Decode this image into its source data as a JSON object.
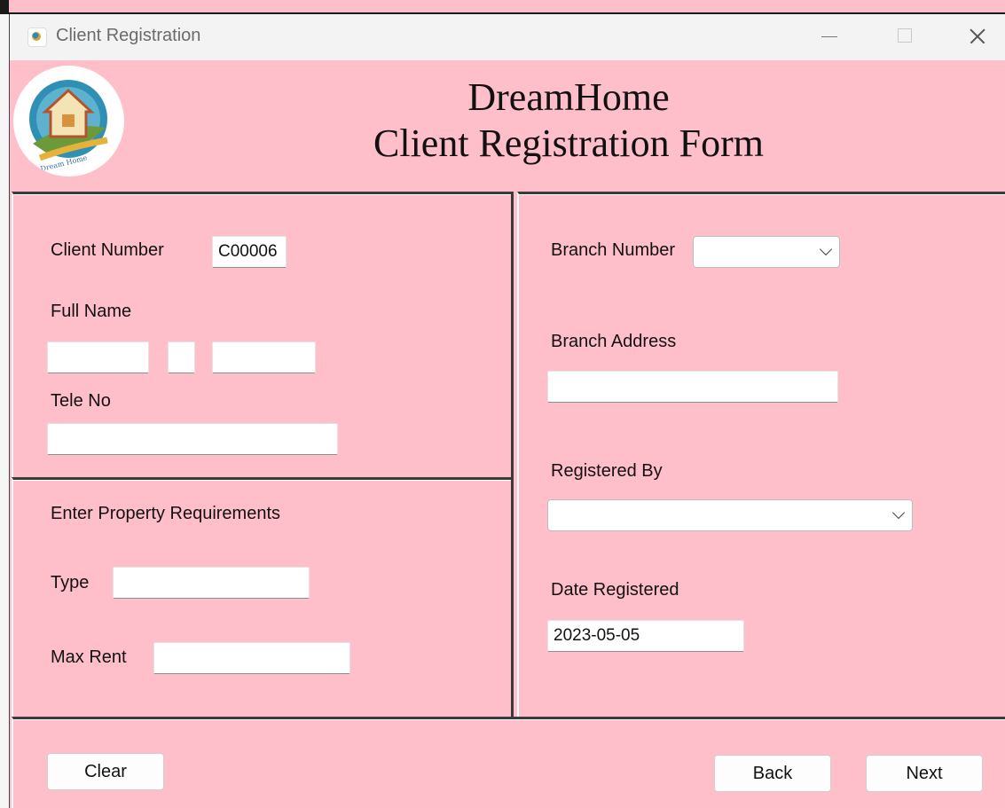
{
  "window": {
    "title": "Client Registration",
    "icon": "app-logo-icon"
  },
  "header": {
    "line1": "DreamHome",
    "line2": "Client Registration Form",
    "logo_text": "Dream Home"
  },
  "client": {
    "number_label": "Client Number",
    "number_value": "C00006",
    "full_name_label": "Full Name",
    "first_name_value": "",
    "middle_initial_value": "",
    "last_name_value": "",
    "tele_label": "Tele No",
    "tele_value": ""
  },
  "requirements": {
    "heading": "Enter Property Requirements",
    "type_label": "Type",
    "type_value": "",
    "max_rent_label": "Max Rent",
    "max_rent_value": ""
  },
  "branch": {
    "number_label": "Branch Number",
    "number_selected": "",
    "address_label": "Branch Address",
    "address_value": "",
    "registered_by_label": "Registered By",
    "registered_by_selected": "",
    "date_label": "Date Registered",
    "date_value": "2023-05-05"
  },
  "buttons": {
    "clear": "Clear",
    "back": "Back",
    "next": "Next"
  },
  "colors": {
    "form_bg": "#ffbfca",
    "titlebar_bg": "#f3f3f3"
  }
}
